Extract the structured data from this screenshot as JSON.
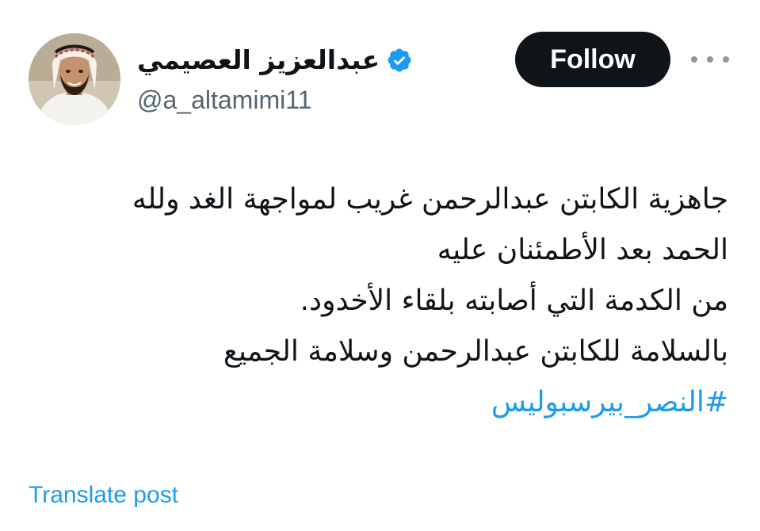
{
  "author": {
    "display_name": "عبدالعزيز العصيمي",
    "handle": "@a_altamimi11",
    "verified": true,
    "verified_color": "#1d9bf0"
  },
  "actions": {
    "follow_label": "Follow",
    "more_icon": "more-horizontal-icon"
  },
  "post": {
    "lines": [
      "جاهزية الكابتن عبدالرحمن غريب لمواجهة الغد ولله",
      "الحمد بعد الأطمئنان عليه",
      "من الكدمة التي أصابته بلقاء الأخدود.",
      "بالسلامة للكابتن عبدالرحمن وسلامة الجميع"
    ],
    "hashtag": "#النصر_بيرسبوليس"
  },
  "footer": {
    "translate_label": "Translate post"
  },
  "colors": {
    "text": "#0f1419",
    "secondary": "#536471",
    "link": "#1d9bf0",
    "button_bg": "#0f1419"
  }
}
